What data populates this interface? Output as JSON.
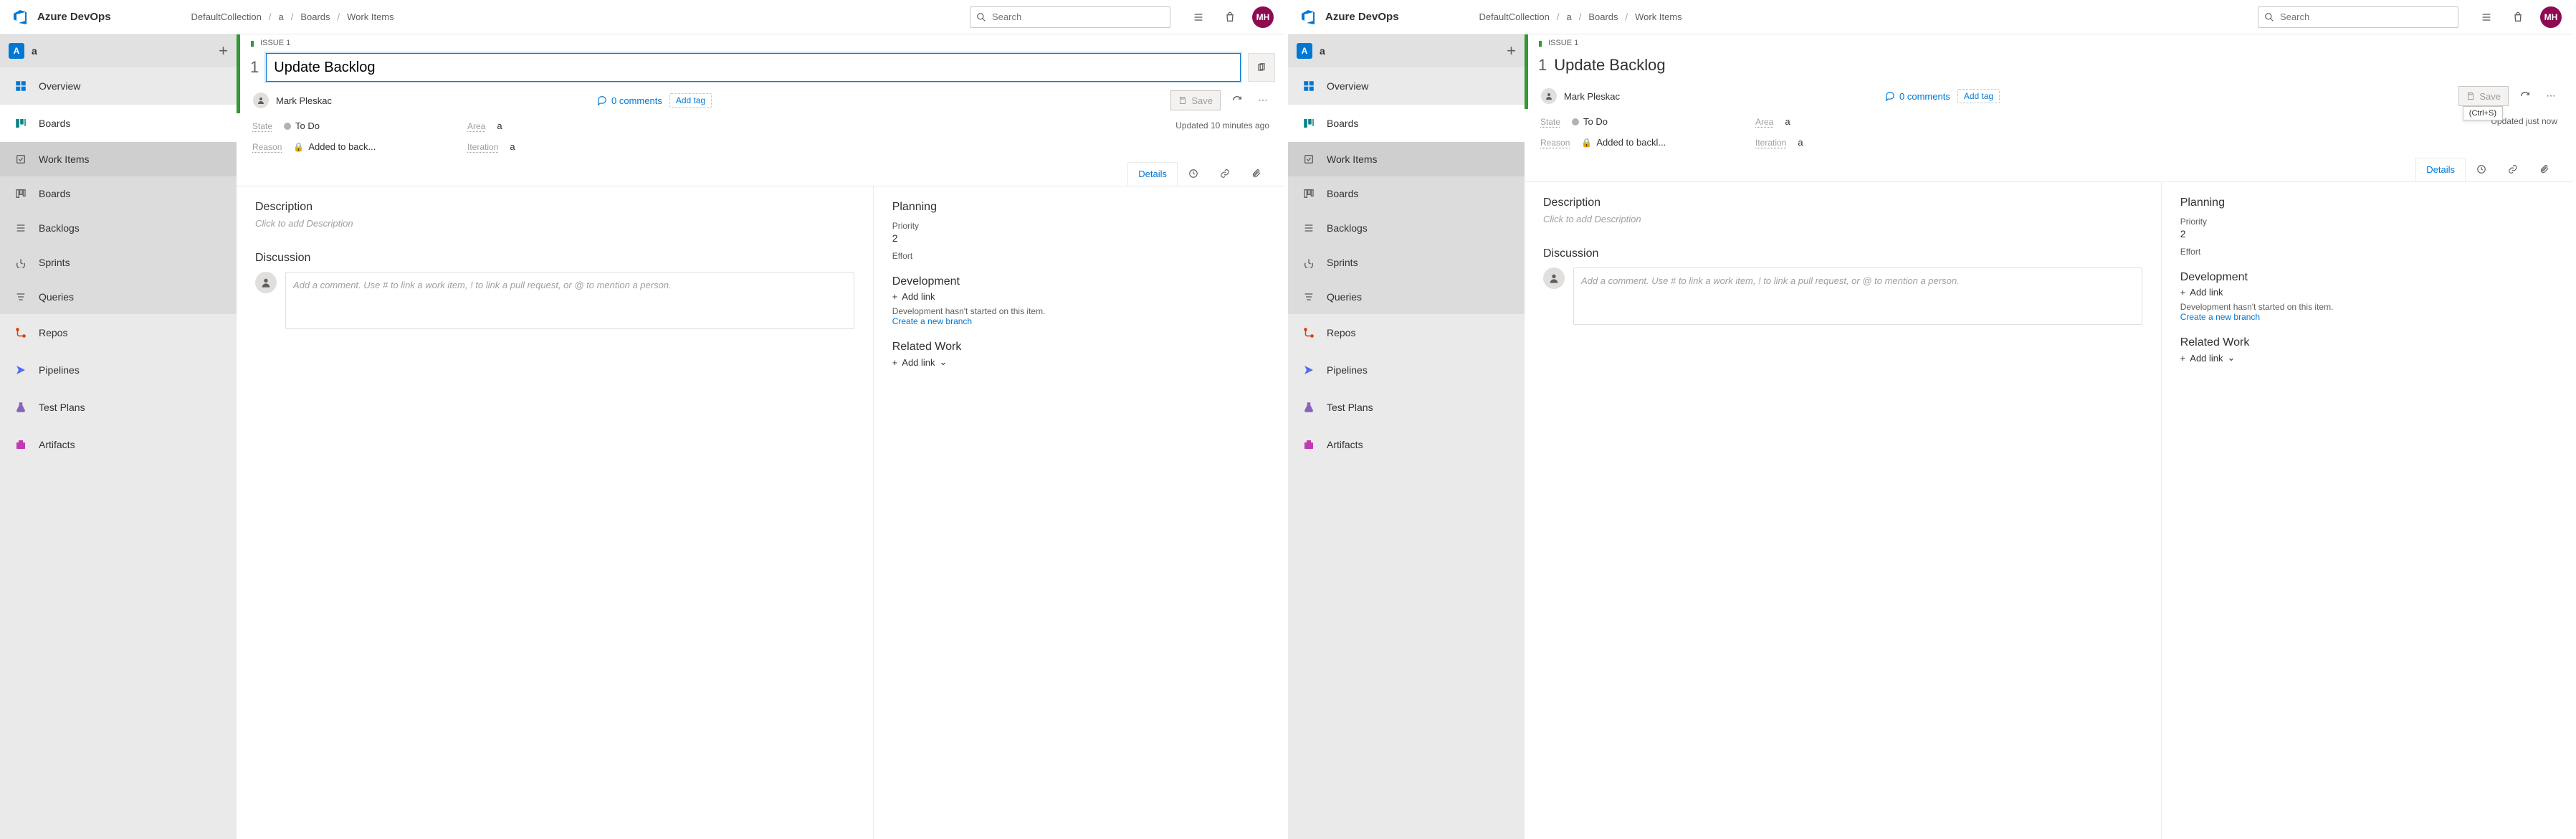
{
  "product": "Azure DevOps",
  "breadcrumb": [
    "DefaultCollection",
    "a",
    "Boards",
    "Work Items"
  ],
  "search_placeholder": "Search",
  "avatar_initials": "MH",
  "project": {
    "badge": "A",
    "name": "a"
  },
  "sidebar": {
    "overview": "Overview",
    "boards": "Boards",
    "sub": {
      "work_items": "Work Items",
      "boards": "Boards",
      "backlogs": "Backlogs",
      "sprints": "Sprints",
      "queries": "Queries"
    },
    "repos": "Repos",
    "pipelines": "Pipelines",
    "test_plans": "Test Plans",
    "artifacts": "Artifacts"
  },
  "issue": {
    "label": "ISSUE 1",
    "number": "1",
    "title": "Update Backlog",
    "assignee": "Mark Pleskac",
    "comments_count": "0 comments",
    "add_tag": "Add tag",
    "save": "Save",
    "save_tooltip": "(Ctrl+S)",
    "state_label": "State",
    "state": "To Do",
    "area_label": "Area",
    "area": "a",
    "reason_label": "Reason",
    "reason_left": "Added to back...",
    "reason_right": "Added to backl...",
    "iteration_label": "Iteration",
    "iteration": "a",
    "updated_left": "Updated 10 minutes ago",
    "updated_right": "Updated just now"
  },
  "tabs": {
    "details": "Details"
  },
  "sections": {
    "description": "Description",
    "description_ph": "Click to add Description",
    "discussion": "Discussion",
    "discussion_ph": "Add a comment. Use # to link a work item, ! to link a pull request, or @ to mention a person.",
    "planning": "Planning",
    "priority_label": "Priority",
    "priority_value": "2",
    "effort_label": "Effort",
    "development": "Development",
    "add_link": "Add link",
    "dev_note": "Development hasn't started on this item.",
    "create_branch": "Create a new branch",
    "related_work": "Related Work"
  }
}
